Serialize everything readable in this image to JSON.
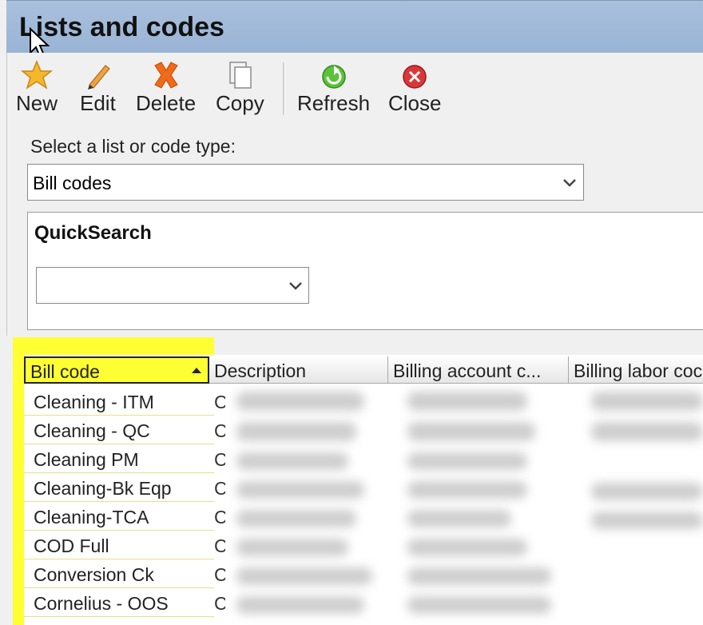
{
  "window": {
    "title": "Lists and codes"
  },
  "toolbar": {
    "new_label": "New",
    "edit_label": "Edit",
    "delete_label": "Delete",
    "copy_label": "Copy",
    "refresh_label": "Refresh",
    "close_label": "Close"
  },
  "selector": {
    "label": "Select a list or code type:",
    "value": "Bill codes"
  },
  "quicksearch": {
    "title": "QuickSearch",
    "value": ""
  },
  "grid": {
    "columns": [
      "Bill code",
      "Description",
      "Billing account c...",
      "Billing labor coc"
    ],
    "sorted_column": "Bill code",
    "rows": [
      {
        "bill_code": "Cleaning - ITM",
        "desc_initial": "C"
      },
      {
        "bill_code": "Cleaning - QC",
        "desc_initial": "C"
      },
      {
        "bill_code": "Cleaning PM",
        "desc_initial": "C"
      },
      {
        "bill_code": "Cleaning-Bk Eqp",
        "desc_initial": "C"
      },
      {
        "bill_code": "Cleaning-TCA",
        "desc_initial": "C"
      },
      {
        "bill_code": "COD Full",
        "desc_initial": "C"
      },
      {
        "bill_code": "Conversion Ck",
        "desc_initial": "C"
      },
      {
        "bill_code": "Cornelius - OOS",
        "desc_initial": "C"
      }
    ]
  },
  "colors": {
    "highlight": "#ffff33",
    "titlebar": "#9ab4d6"
  },
  "icons": [
    "star-icon",
    "pencil-icon",
    "delete-x-icon",
    "copy-icon",
    "refresh-icon",
    "close-icon",
    "chevron-down-icon",
    "mouse-cursor-icon"
  ]
}
